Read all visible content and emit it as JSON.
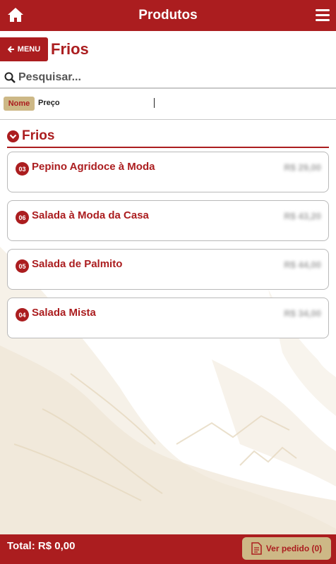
{
  "header": {
    "title": "Produtos",
    "home_icon": "home-icon",
    "menu_icon": "hamburger-menu-icon"
  },
  "nav": {
    "back_label": "MENU",
    "page_title": "Frios"
  },
  "search": {
    "placeholder": "Pesquisar..."
  },
  "sort": {
    "nome_label": "Nome",
    "preco_label": "Preço"
  },
  "section": {
    "title": "Frios"
  },
  "products": [
    {
      "number": "03",
      "name": "Pepino Agridoce à Moda",
      "price": "R$ 29,00"
    },
    {
      "number": "06",
      "name": "Salada à Moda da Casa",
      "price": "R$ 43,20"
    },
    {
      "number": "05",
      "name": "Salada de Palmito",
      "price": "R$ 44,00"
    },
    {
      "number": "04",
      "name": "Salada Mista",
      "price": "R$ 34,00"
    }
  ],
  "footer": {
    "total": "Total: R$ 0,00",
    "order_button": "Ver pedido (0)"
  },
  "colors": {
    "brand_red": "#ab1d1f",
    "accent_tan": "#cdb886"
  }
}
